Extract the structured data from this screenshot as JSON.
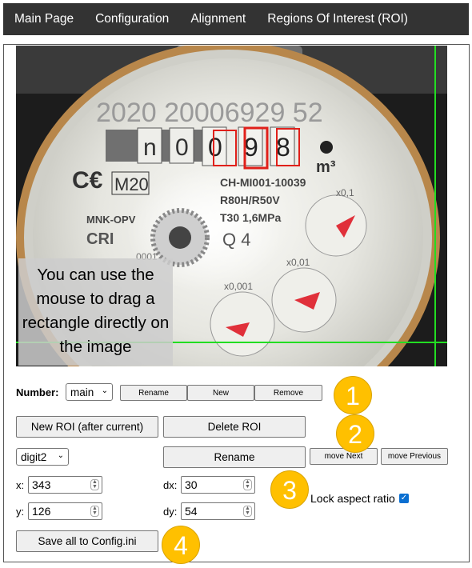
{
  "nav": {
    "items": [
      "Main Page",
      "Configuration",
      "Alignment",
      "Regions Of Interest (ROI)"
    ]
  },
  "image": {
    "overlay_note": "You can use the mouse to drag a rectangle directly on the image",
    "meter_serial": "2020 20006929 52",
    "digits": [
      "n",
      "0",
      "0",
      "9",
      "8"
    ],
    "unit": "m³",
    "cert": "M20",
    "model": "CH-MI001-10039",
    "ratio": "R80H/R50V",
    "temp_pressure": "T30   1,6MPa",
    "maker": "MNK-OPV",
    "cri": "CRI",
    "q": "Q 4",
    "dial_labels": [
      "x0,1",
      "x0,01",
      "x0,001",
      "0001"
    ]
  },
  "controls": {
    "number_label": "Number:",
    "number_value": "main",
    "rename_label": "Rename",
    "new_label": "New",
    "remove_label": "Remove",
    "new_roi_label": "New ROI (after current)",
    "delete_roi_label": "Delete ROI",
    "roi_value": "digit2",
    "roi_rename_label": "Rename",
    "move_next_label": "move Next",
    "move_previous_label": "move Previous",
    "x_label": "x:",
    "x_value": "343",
    "y_label": "y:",
    "y_value": "126",
    "dx_label": "dx:",
    "dx_value": "30",
    "dy_label": "dy:",
    "dy_value": "54",
    "lock_label": "Lock aspect ratio",
    "lock_checked": true,
    "save_label": "Save all to Config.ini"
  },
  "badges": [
    "1",
    "2",
    "3",
    "4"
  ],
  "colors": {
    "nav_bg": "#333333",
    "badge": "#ffc000",
    "roi_box": "#e0201a",
    "guide_line": "#22dd22",
    "checkbox": "#0a6fd1"
  }
}
